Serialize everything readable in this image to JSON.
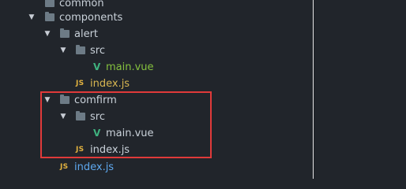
{
  "tree": {
    "items": [
      {
        "label": "common",
        "icon": "folder-icon"
      },
      {
        "label": "components",
        "icon": "folder-icon",
        "expanded": true
      },
      {
        "label": "alert",
        "icon": "folder-icon",
        "expanded": true
      },
      {
        "label": "src",
        "icon": "folder-icon",
        "expanded": true
      },
      {
        "label": "main.vue",
        "icon": "vue-file-icon",
        "badge": "V"
      },
      {
        "label": "index.js",
        "icon": "js-file-icon",
        "badge": "JS"
      },
      {
        "label": "comfirm",
        "icon": "folder-icon",
        "expanded": true
      },
      {
        "label": "src",
        "icon": "folder-icon",
        "expanded": true
      },
      {
        "label": "main.vue",
        "icon": "vue-file-icon",
        "badge": "V"
      },
      {
        "label": "index.js",
        "icon": "js-file-icon",
        "badge": "JS"
      },
      {
        "label": "index.js",
        "icon": "js-file-icon",
        "badge": "JS"
      }
    ],
    "arrow_glyph": "▼"
  },
  "colors": {
    "background": "#21252b",
    "folder_icon": "#6d7b86",
    "js_badge": "#e2b23f",
    "vue_badge": "#3fb27f",
    "modified_green": "#85c13e",
    "modified_yellow": "#d8b651",
    "new_blue": "#5ea8ee",
    "highlight_red": "#e03a3a"
  }
}
